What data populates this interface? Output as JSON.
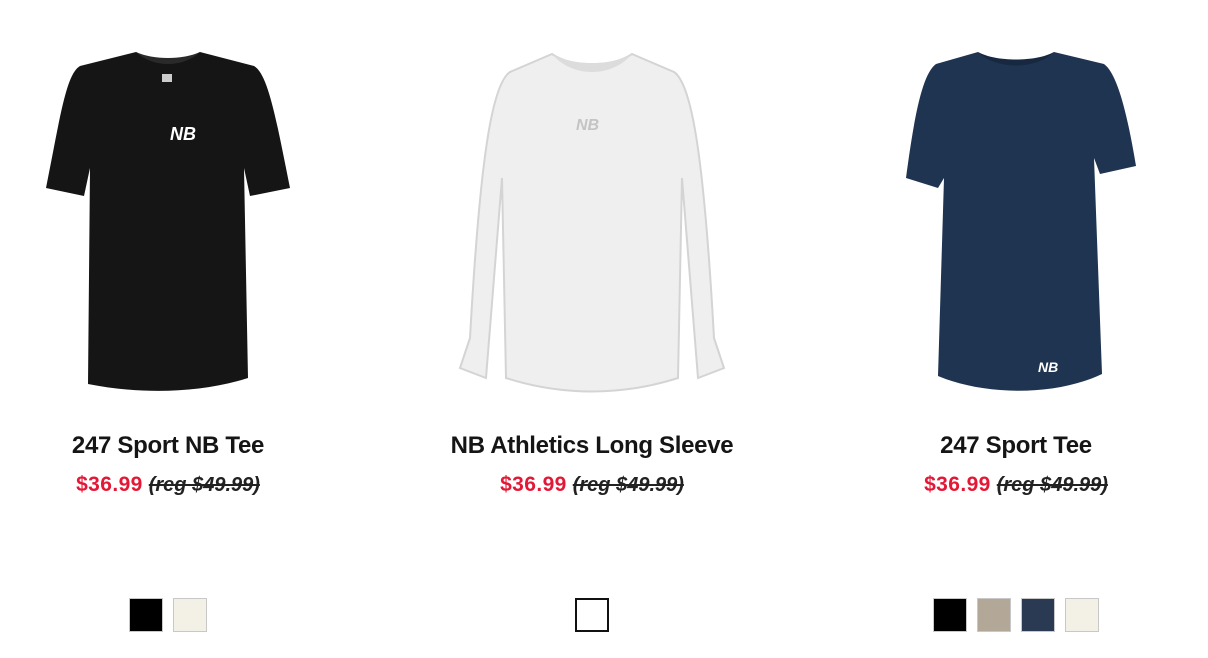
{
  "products": [
    {
      "name": "247 Sport NB Tee",
      "sale_price": "$36.99",
      "reg_price": "(reg $49.99)",
      "image_icon": "black-short-sleeve-tee-image",
      "swatches": [
        {
          "color": "#000000",
          "name": "swatch-black"
        },
        {
          "color": "#f3f0e6",
          "name": "swatch-cream"
        }
      ]
    },
    {
      "name": "NB Athletics Long Sleeve",
      "sale_price": "$36.99",
      "reg_price": "(reg $49.99)",
      "image_icon": "white-long-sleeve-tee-image",
      "swatches": [
        {
          "color": "#ffffff",
          "name": "swatch-white"
        }
      ]
    },
    {
      "name": "247 Sport Tee",
      "sale_price": "$36.99",
      "reg_price": "(reg $49.99)",
      "image_icon": "navy-short-sleeve-tee-image",
      "swatches": [
        {
          "color": "#000000",
          "name": "swatch-black"
        },
        {
          "color": "#b3a897",
          "name": "swatch-taupe"
        },
        {
          "color": "#2a3a52",
          "name": "swatch-navy"
        },
        {
          "color": "#f3f0e6",
          "name": "swatch-cream"
        }
      ]
    }
  ],
  "colors": {
    "sale_price": "#e21836",
    "shirt_black": "#151515",
    "shirt_white": "#f2f2f2",
    "shirt_navy": "#1f3450"
  }
}
